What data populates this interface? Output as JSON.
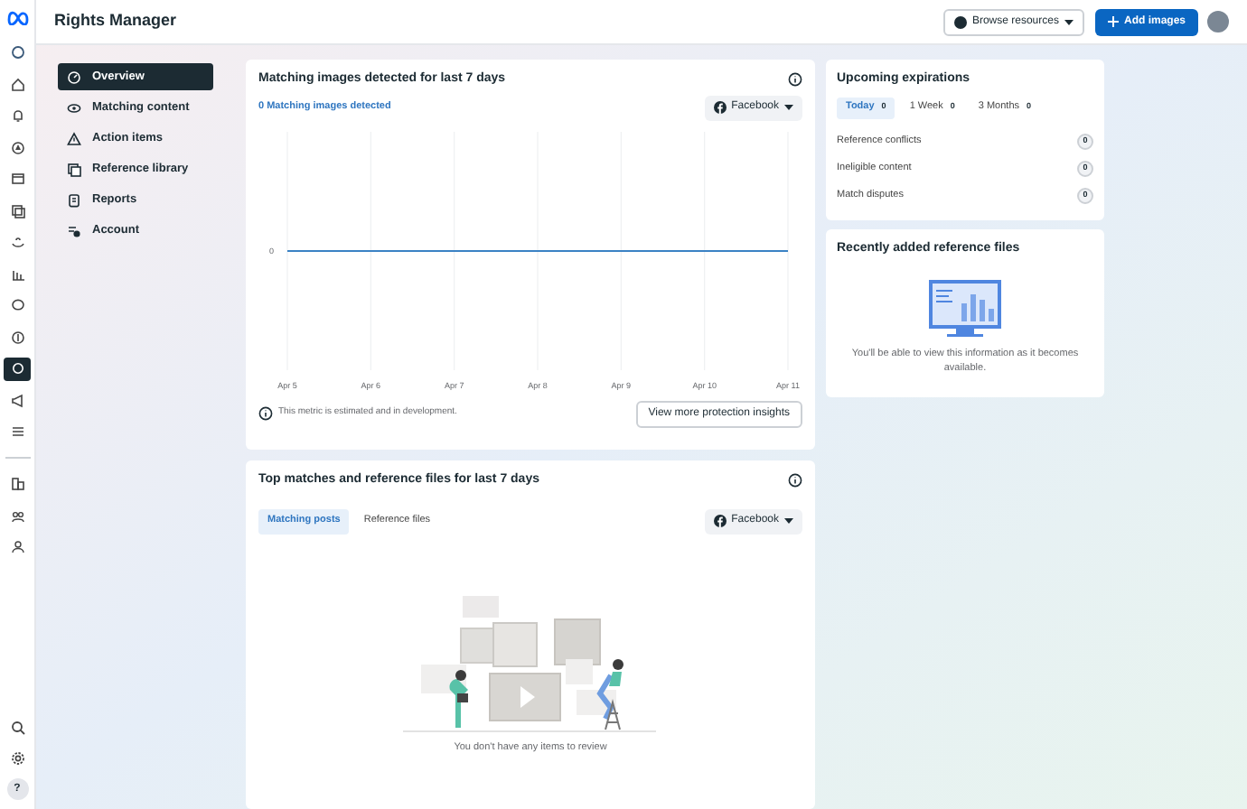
{
  "header": {
    "title": "Rights Manager",
    "browse_button": "Browse resources",
    "add_button": "Add images"
  },
  "rail_items": [
    {
      "selected": false
    },
    {
      "selected": false
    },
    {
      "selected": false
    },
    {
      "selected": false
    },
    {
      "selected": false
    },
    {
      "selected": false
    },
    {
      "selected": false
    },
    {
      "selected": false
    },
    {
      "selected": false
    },
    {
      "selected": false
    },
    {
      "selected": true
    },
    {
      "selected": false
    },
    {
      "selected": false
    }
  ],
  "rail_bottom_items": [
    {
      "selected": false
    },
    {
      "selected": false
    },
    {
      "selected": false
    }
  ],
  "rail_footer": [
    {
      "label": "?"
    }
  ],
  "sidebar": {
    "items": [
      {
        "label": "Overview",
        "selected": true
      },
      {
        "label": "Matching content",
        "selected": false
      },
      {
        "label": "Action items",
        "selected": false
      },
      {
        "label": "Reference library",
        "selected": false
      },
      {
        "label": "Reports",
        "selected": false
      },
      {
        "label": "Account",
        "selected": false
      }
    ]
  },
  "matching_card": {
    "title": "Matching images detected",
    "title_suffix": " for last 7 days",
    "legend": "0 Matching images detected",
    "platform": "Facebook",
    "note": "This metric is estimated and in development.",
    "button": "View more protection insights",
    "chart": {
      "y_label": "0",
      "x_labels": [
        "Apr 5",
        "Apr 6",
        "Apr 7",
        "Apr 8",
        "Apr 9",
        "Apr 10",
        "Apr 11"
      ]
    }
  },
  "top_card": {
    "title": "Top matches and reference files for last 7 days",
    "tabs": [
      {
        "label": "Matching posts",
        "selected": true
      },
      {
        "label": "Reference files",
        "selected": false
      }
    ],
    "platform": "Facebook",
    "empty_text": "You don't have any items to review"
  },
  "expirations": {
    "title": "Upcoming expirations",
    "tabs": [
      {
        "label": "Today",
        "count": "0",
        "selected": true
      },
      {
        "label": "1 Week",
        "count": "0",
        "selected": false
      },
      {
        "label": "3 Months",
        "count": "0",
        "selected": false
      }
    ],
    "rows": [
      {
        "label": "Reference conflicts",
        "count": "0"
      },
      {
        "label": "Ineligible content",
        "count": "0"
      },
      {
        "label": "Match disputes",
        "count": "0"
      }
    ]
  },
  "recent": {
    "title": "Recently added reference files",
    "message": "You'll be able to view this information as it becomes available."
  }
}
